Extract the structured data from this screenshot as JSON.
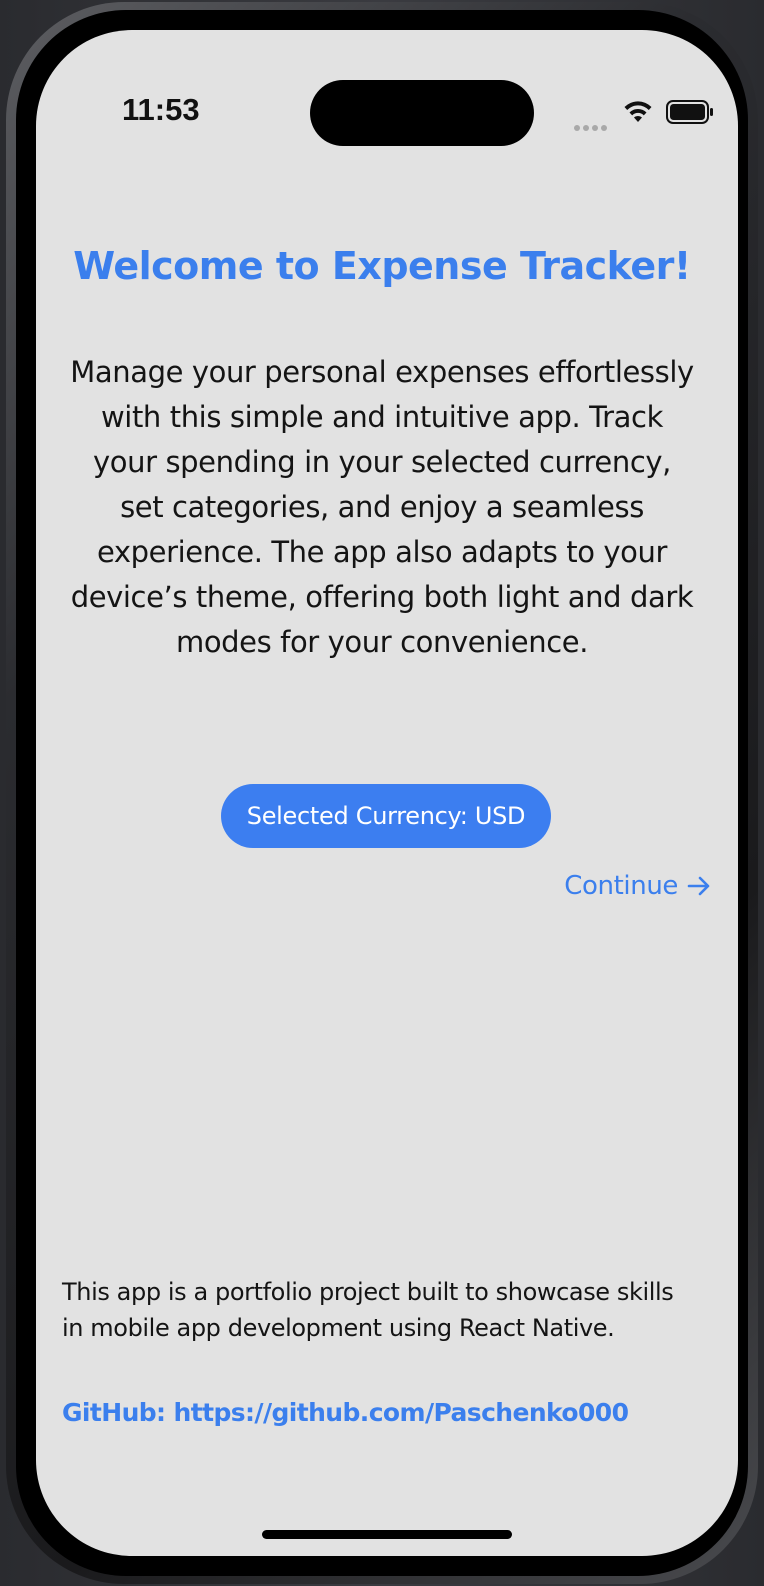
{
  "status_bar": {
    "time": "11:53",
    "icons": [
      "signal-icon",
      "wifi-icon",
      "battery-icon"
    ]
  },
  "welcome": {
    "title": "Welcome to Expense Tracker!",
    "description": "Manage your personal expenses effortlessly with this simple and intuitive app. Track your spending in your selected currency, set categories, and enjoy a seamless experience. The app also adapts to your device’s theme, offering both light and dark modes for your convenience."
  },
  "currency_button": {
    "label": "Selected Currency: USD"
  },
  "continue_button": {
    "label": "Continue",
    "icon": "arrow-right-icon"
  },
  "footer": {
    "about": "This app is a portfolio project built to showcase skills in mobile app development using React Native.",
    "github": "GitHub: https://github.com/Paschenko000"
  },
  "colors": {
    "accent": "#3b7fed",
    "background": "#e2e2e2",
    "text": "#141414"
  }
}
